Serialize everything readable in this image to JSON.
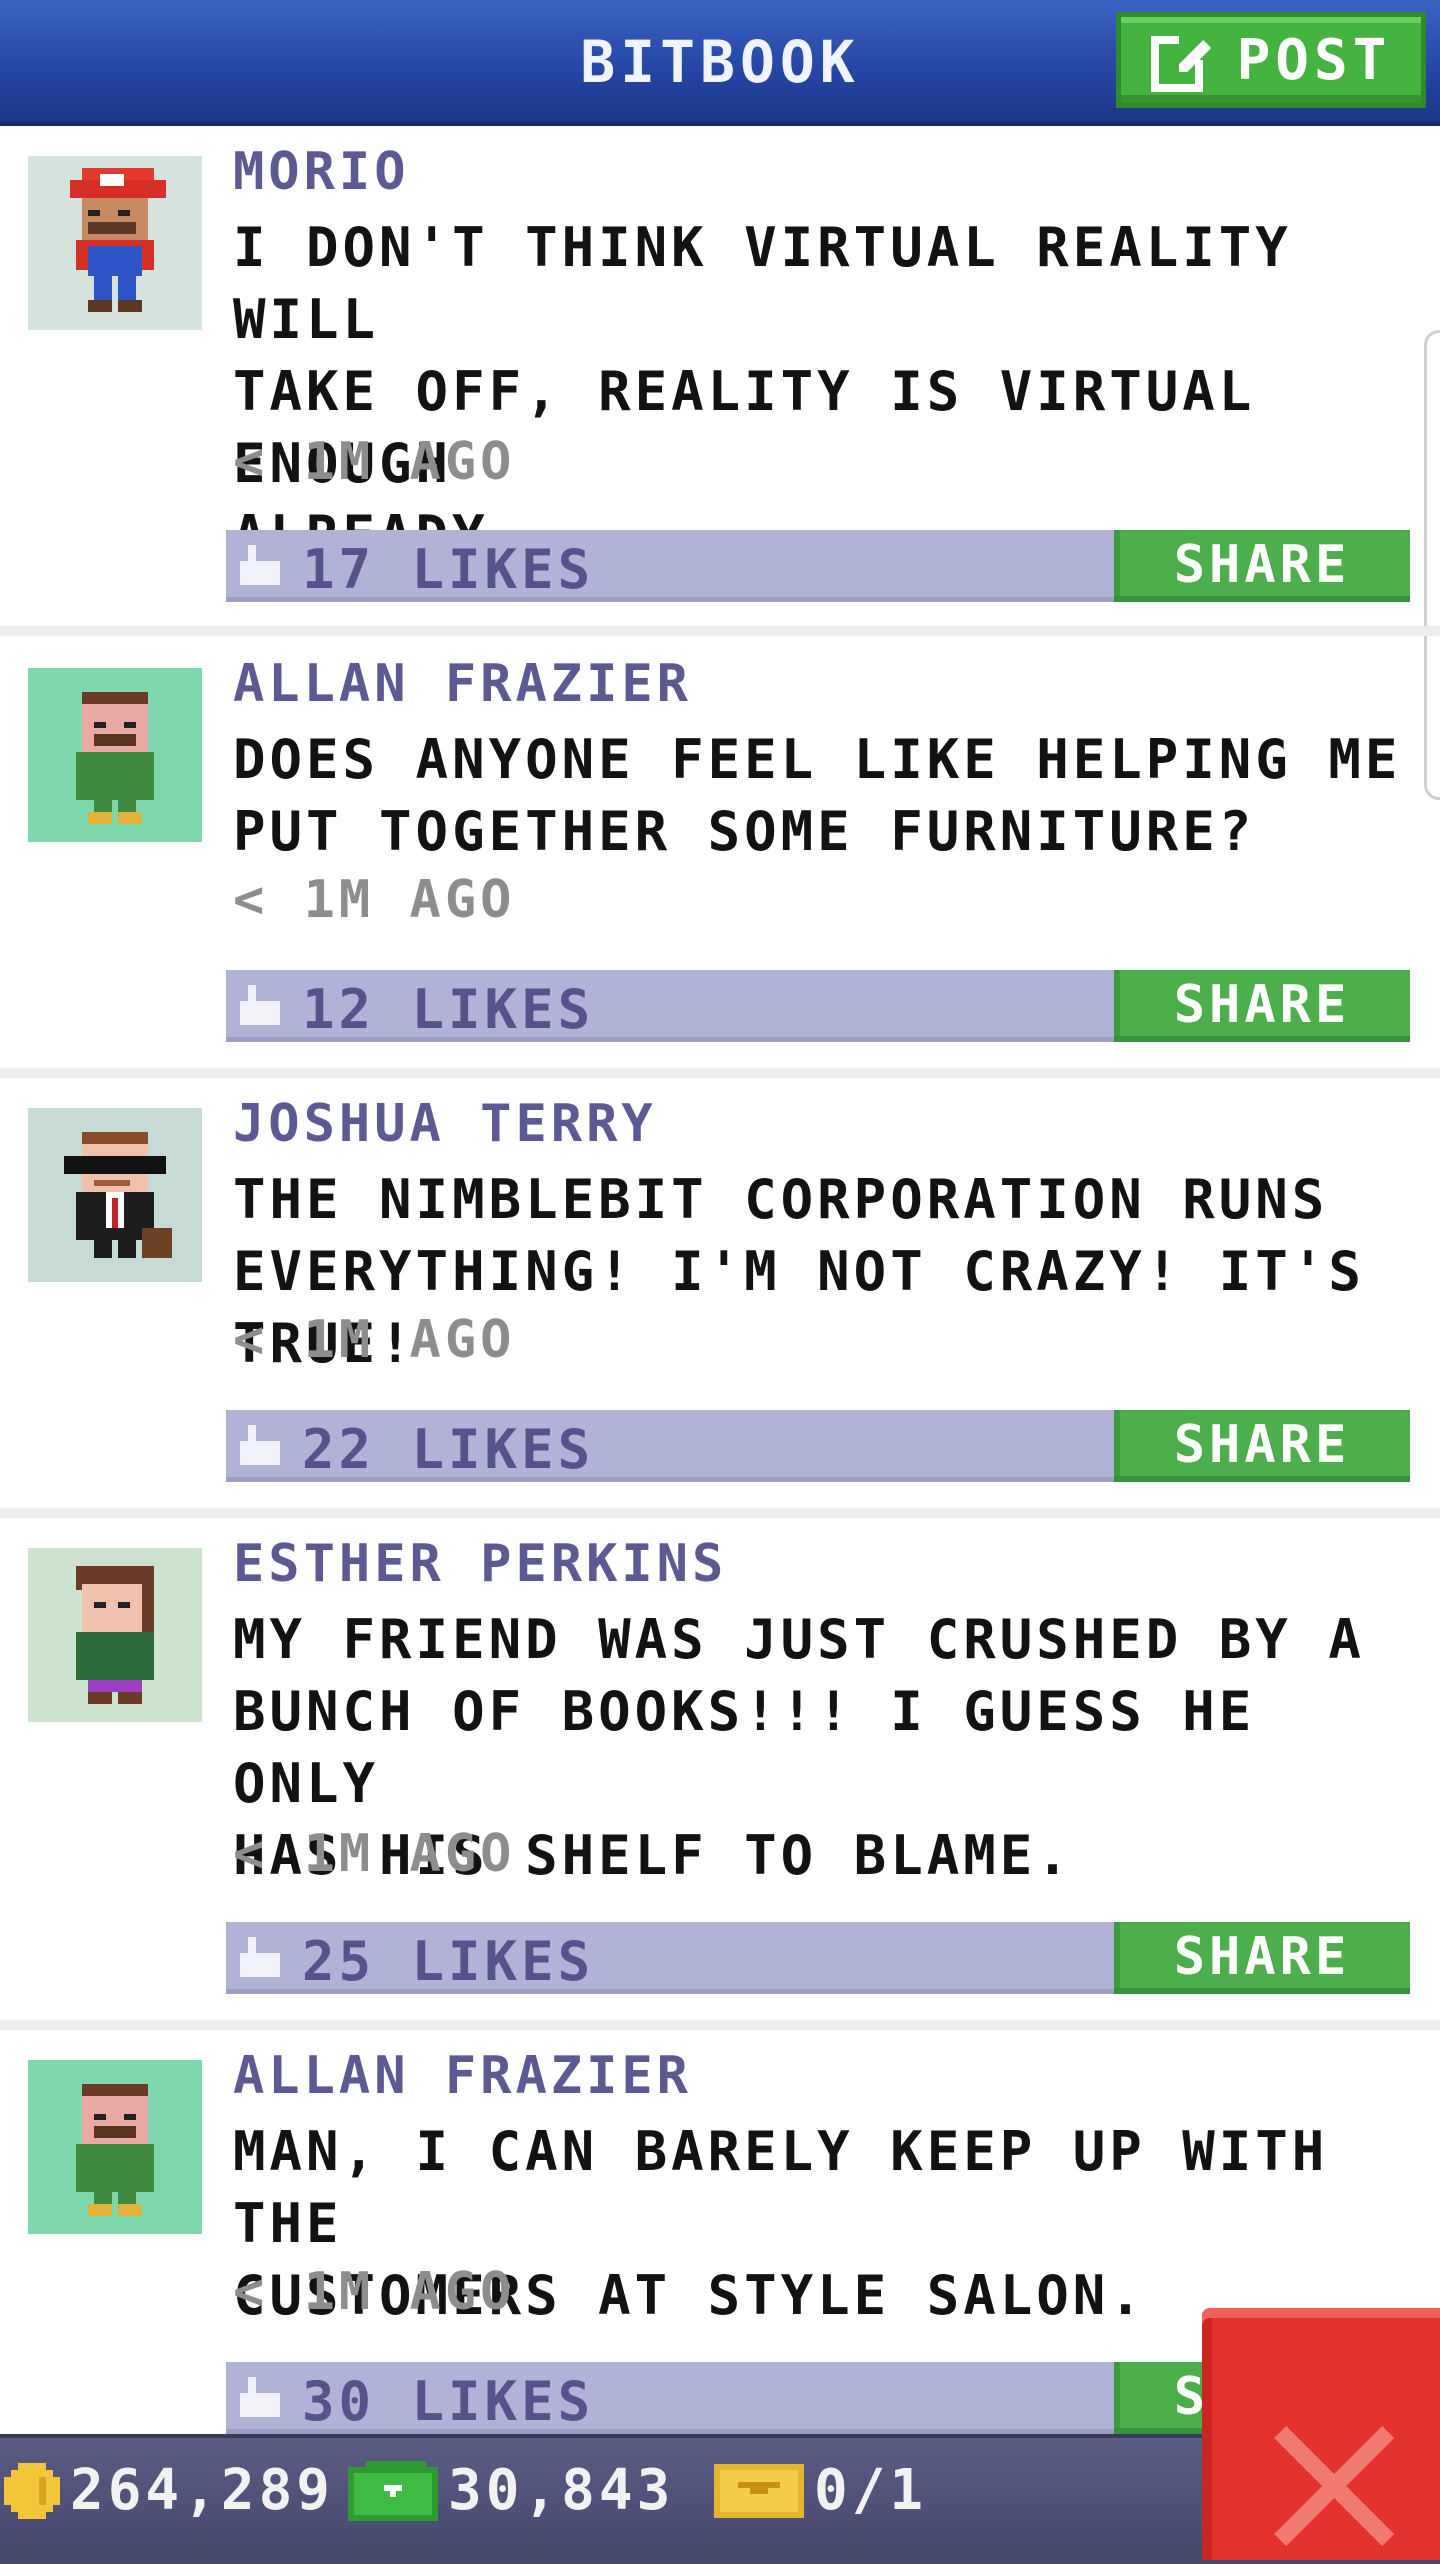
{
  "header": {
    "title": "BITBOOK",
    "post_label": "POST"
  },
  "posts": [
    {
      "name": "MORIO",
      "text": "I DON'T THINK VIRTUAL REALITY WILL\nTAKE OFF, REALITY IS VIRTUAL ENOUGH\nALREADY.",
      "time": "< 1M AGO",
      "likes": "17 LIKES",
      "share": "SHARE",
      "avatar": "morio-avatar"
    },
    {
      "name": "ALLAN FRAZIER",
      "text": "DOES ANYONE FEEL LIKE HELPING ME\nPUT TOGETHER SOME FURNITURE?",
      "time": "< 1M AGO",
      "likes": "12 LIKES",
      "share": "SHARE",
      "avatar": "allan-avatar"
    },
    {
      "name": "JOSHUA TERRY",
      "text": "THE NIMBLEBIT CORPORATION RUNS\nEVERYTHING! I'M NOT CRAZY! IT'S TRUE!",
      "time": "< 1M AGO",
      "likes": "22 LIKES",
      "share": "SHARE",
      "avatar": "joshua-avatar"
    },
    {
      "name": "ESTHER PERKINS",
      "text": "MY FRIEND WAS JUST CRUSHED BY A\nBUNCH OF BOOKS!!! I GUESS HE ONLY\nHAS HIS SHELF TO BLAME.",
      "time": "< 1M AGO",
      "likes": "25 LIKES",
      "share": "SHARE",
      "avatar": "esther-avatar"
    },
    {
      "name": "ALLAN FRAZIER",
      "text": "MAN, I CAN BARELY KEEP UP WITH THE\nCUSTOMERS AT STYLE SALON.",
      "time": "< 1M AGO",
      "likes": "30 LIKES",
      "share": "SHARE",
      "avatar": "allan-avatar"
    }
  ],
  "footer": {
    "coins": "264,289",
    "bux": "30,843",
    "tickets": "0/1"
  },
  "colors": {
    "header": "#2647a6",
    "post_green": "#45b340",
    "likes_bar": "#b1b3d6",
    "close_red": "#e4332e"
  }
}
